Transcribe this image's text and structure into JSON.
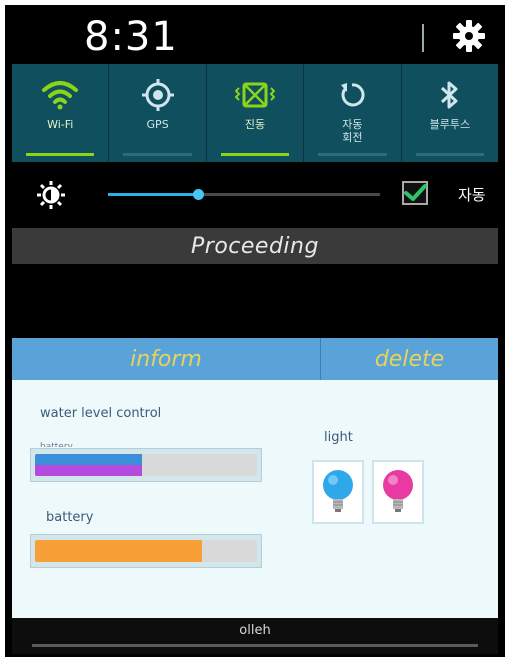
{
  "status_bar": {
    "time": "8:31"
  },
  "quick_toggles": [
    {
      "label": "Wi-Fi",
      "icon": "wifi-icon",
      "on": true
    },
    {
      "label": "GPS",
      "icon": "gps-icon",
      "on": false
    },
    {
      "label": "진동",
      "icon": "vibrate-icon",
      "on": true
    },
    {
      "label": "자동\n회전",
      "icon": "rotate-icon",
      "on": false
    },
    {
      "label": "블루투스",
      "icon": "bluetooth-icon",
      "on": false
    }
  ],
  "brightness": {
    "level": 0.33,
    "auto_checked": true,
    "auto_label": "자동"
  },
  "banner": {
    "text": "Proceeding"
  },
  "tabs": {
    "inform": "inform",
    "delete": "delete"
  },
  "panel": {
    "water_level_title": "water level control",
    "water_level_faint": "battery",
    "water_level": {
      "blue": 0.48,
      "purple": 0.48
    },
    "battery_title": "battery",
    "battery_level": 0.75,
    "light_title": "light",
    "lights": [
      {
        "icon": "blue-bulb-icon",
        "color": "#2fa8ea"
      },
      {
        "icon": "pink-bulb-icon",
        "color": "#e93aa3"
      }
    ]
  },
  "footer": {
    "carrier": "olleh"
  },
  "colors": {
    "accent_green": "#8ad41a",
    "toggle_bg": "#0f4f5e",
    "tab_bg": "#5aa3d9",
    "tab_text": "#e7d35a",
    "battery_orange": "#f7a038"
  }
}
